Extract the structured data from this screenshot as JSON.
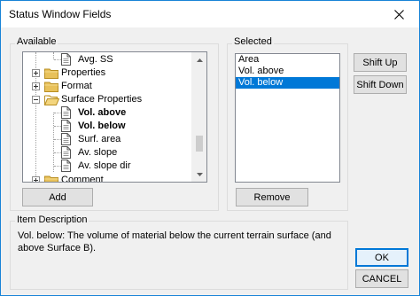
{
  "window": {
    "title": "Status Window Fields"
  },
  "available": {
    "label": "Available",
    "tree": [
      {
        "label": "Avg. SS",
        "kind": "leaf",
        "bold": false
      },
      {
        "label": "Properties",
        "kind": "folder",
        "bold": false
      },
      {
        "label": "Format",
        "kind": "folder",
        "bold": false
      },
      {
        "label": "Surface Properties",
        "kind": "folder-open",
        "bold": false
      },
      {
        "label": "Vol. above",
        "kind": "leaf",
        "bold": true
      },
      {
        "label": "Vol. below",
        "kind": "leaf",
        "bold": true
      },
      {
        "label": "Surf. area",
        "kind": "leaf",
        "bold": false
      },
      {
        "label": "Av. slope",
        "kind": "leaf",
        "bold": false
      },
      {
        "label": "Av. slope dir",
        "kind": "leaf",
        "bold": false
      },
      {
        "label": "Comment",
        "kind": "folder",
        "bold": false
      }
    ],
    "add_button": "Add"
  },
  "selected": {
    "label": "Selected",
    "items": [
      "Area",
      "Vol. above",
      "Vol. below"
    ],
    "selected_index": 2,
    "remove_button": "Remove",
    "shift_up_button": "Shift Up",
    "shift_down_button": "Shift Down"
  },
  "item_description": {
    "label": "Item Description",
    "text": "Vol. below: The volume of material below the current terrain surface (and above Surface B)."
  },
  "buttons": {
    "ok": "OK",
    "cancel": "CANCEL"
  },
  "icons": {
    "close": "close-icon",
    "folder": "folder-icon",
    "document": "document-icon",
    "expand": "plus-box-icon",
    "collapse": "minus-box-icon"
  },
  "colors": {
    "accent": "#0078d7",
    "window_border": "#1883d7",
    "folder": "#e8c15a"
  }
}
